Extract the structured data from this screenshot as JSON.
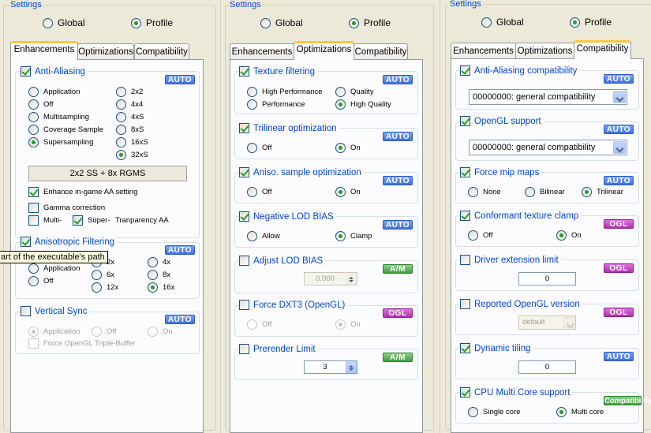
{
  "panel1": {
    "settings_label": "Settings",
    "global_label": "Global",
    "profile_label": "Profile",
    "tabs": [
      "Enhancements",
      "Optimizations",
      "Compatibility"
    ],
    "aa": {
      "title": "Anti-Aliasing",
      "badge": "AUTO",
      "modes": [
        "Application",
        "Off",
        "Multisampling",
        "Coverage Sample",
        "Supersampling"
      ],
      "levels": [
        "2x2",
        "4x4",
        "4xS",
        "8xS",
        "16xS",
        "32xS"
      ],
      "summary": "2x2 SS + 8x RGMS",
      "enhance_label": "Enhance in-game AA setting",
      "gamma_label": "Gamma correction",
      "multi_label": "Multi-",
      "super_label": "Super-",
      "transparency_label": "Tranparency AA"
    },
    "af": {
      "title": "Anisotropic Filtering",
      "badge": "AUTO",
      "modes": [
        "Application",
        "Off"
      ],
      "levels": [
        "2x",
        "4x",
        "6x",
        "8x",
        "12x",
        "16x"
      ]
    },
    "vsync": {
      "title": "Vertical Sync",
      "badge": "AUTO",
      "options": [
        "Application",
        "Off",
        "On"
      ],
      "triple_buffer_label": "Force OpenGL Triple-Buffer"
    },
    "tooltip": "art of the executable's path"
  },
  "panel2": {
    "settings_label": "Settings",
    "global_label": "Global",
    "profile_label": "Profile",
    "tabs": [
      "Enhancements",
      "Optimizations",
      "Compatibility"
    ],
    "texture": {
      "title": "Texture filtering",
      "badge": "AUTO",
      "options": [
        "High Performance",
        "Quality",
        "Performance",
        "High Quality"
      ]
    },
    "trilinear": {
      "title": "Trilinear optimization",
      "badge": "AUTO",
      "off": "Off",
      "on": "On"
    },
    "aniso_opt": {
      "title": "Aniso. sample optimization",
      "badge": "AUTO",
      "off": "Off",
      "on": "On"
    },
    "neg_lod": {
      "title": "Negative LOD BIAS",
      "badge": "AUTO",
      "allow": "Allow",
      "clamp": "Clamp"
    },
    "adjust_lod": {
      "title": "Adjust LOD BIAS",
      "badge": "A/M",
      "value": "0.000"
    },
    "dxt3": {
      "title": "Force DXT3 (OpenGL)",
      "badge": "OGL",
      "off": "Off",
      "on": "On"
    },
    "prerender": {
      "title": "Prerender Limit",
      "badge": "A/M",
      "value": "3"
    }
  },
  "panel3": {
    "settings_label": "Settings",
    "global_label": "Global",
    "profile_label": "Profile",
    "tabs": [
      "Enhancements",
      "Optimizations",
      "Compatibility"
    ],
    "aa_compat": {
      "title": "Anti-Aliasing compatibility",
      "badge": "AUTO",
      "value": "00000000: general compatibility"
    },
    "ogl_support": {
      "title": "OpenGL support",
      "badge": "AUTO",
      "value": "00000000: general compatibility"
    },
    "mip": {
      "title": "Force mip maps",
      "badge": "AUTO",
      "options": [
        "None",
        "Bilinear",
        "Trilinear"
      ]
    },
    "clamp": {
      "title": "Conformant texture clamp",
      "badge": "OGL",
      "off": "Off",
      "on": "On"
    },
    "ext_limit": {
      "title": "Driver extension limit",
      "badge": "OGL",
      "value": "0"
    },
    "gl_version": {
      "title": "Reported OpenGL version",
      "badge": "OGL",
      "value": "default"
    },
    "tiling": {
      "title": "Dynamic tiling",
      "badge": "AUTO",
      "value": "0"
    },
    "multicore": {
      "title": "CPU Multi Core support",
      "badge": "Compatibility",
      "single": "Single core",
      "multi": "Multi core"
    }
  }
}
